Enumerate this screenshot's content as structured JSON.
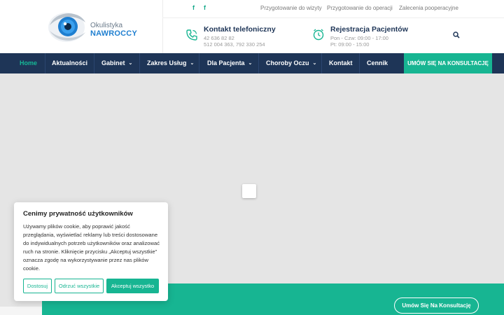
{
  "brand": {
    "line1": "Okulistyka",
    "line2": "NAWROCCY",
    "accent": "#17b592",
    "navy": "#1e3557",
    "logo_blue": "#1f7fd0"
  },
  "topbar": {
    "social": [
      "f",
      "f"
    ],
    "links": [
      "Przygotowanie do wizyty",
      "Przygotowanie do operacji",
      "Zalecenia pooperacyjne"
    ]
  },
  "contact_phone": {
    "icon": "phone-icon",
    "title": "Kontakt telefoniczny",
    "line1": "42 636 82 82",
    "line2": "512 004 363, 792 330 254"
  },
  "registration": {
    "icon": "clock-icon",
    "title": "Rejestracja Pacjentów",
    "line1": "Pon - Czw: 09:00 - 17:00",
    "line2": "Pt: 09:00 - 15:00"
  },
  "nav": {
    "items": [
      {
        "label": "Home",
        "active": true
      },
      {
        "label": "Aktualności"
      },
      {
        "label": "Gabinet",
        "dropdown": true
      },
      {
        "label": "Zakres Usług",
        "dropdown": true
      },
      {
        "label": "Dla Pacjenta",
        "dropdown": true
      },
      {
        "label": "Choroby Oczu",
        "dropdown": true
      },
      {
        "label": "Kontakt"
      },
      {
        "label": "Cennik"
      }
    ],
    "cta": "UMÓW SIĘ NA KONSULTACJĘ",
    "chevron": "⌄"
  },
  "band": {
    "cta": "Umów Się Na Konsultację"
  },
  "cookie": {
    "title": "Cenimy prywatność użytkowników",
    "body": "Używamy plików cookie, aby poprawić jakość przeglądania, wyświetlać reklamy lub treści dostosowane do indywidualnych potrzeb użytkowników oraz analizować ruch na stronie. Kliknięcie przycisku „Akceptuj wszystkie” oznacza zgodę na wykorzystywanie przez nas plików cookie.",
    "buttons": {
      "customize": "Dostosuj",
      "reject": "Odrzuć wszystkie",
      "accept": "Akceptuj wszystko"
    }
  }
}
